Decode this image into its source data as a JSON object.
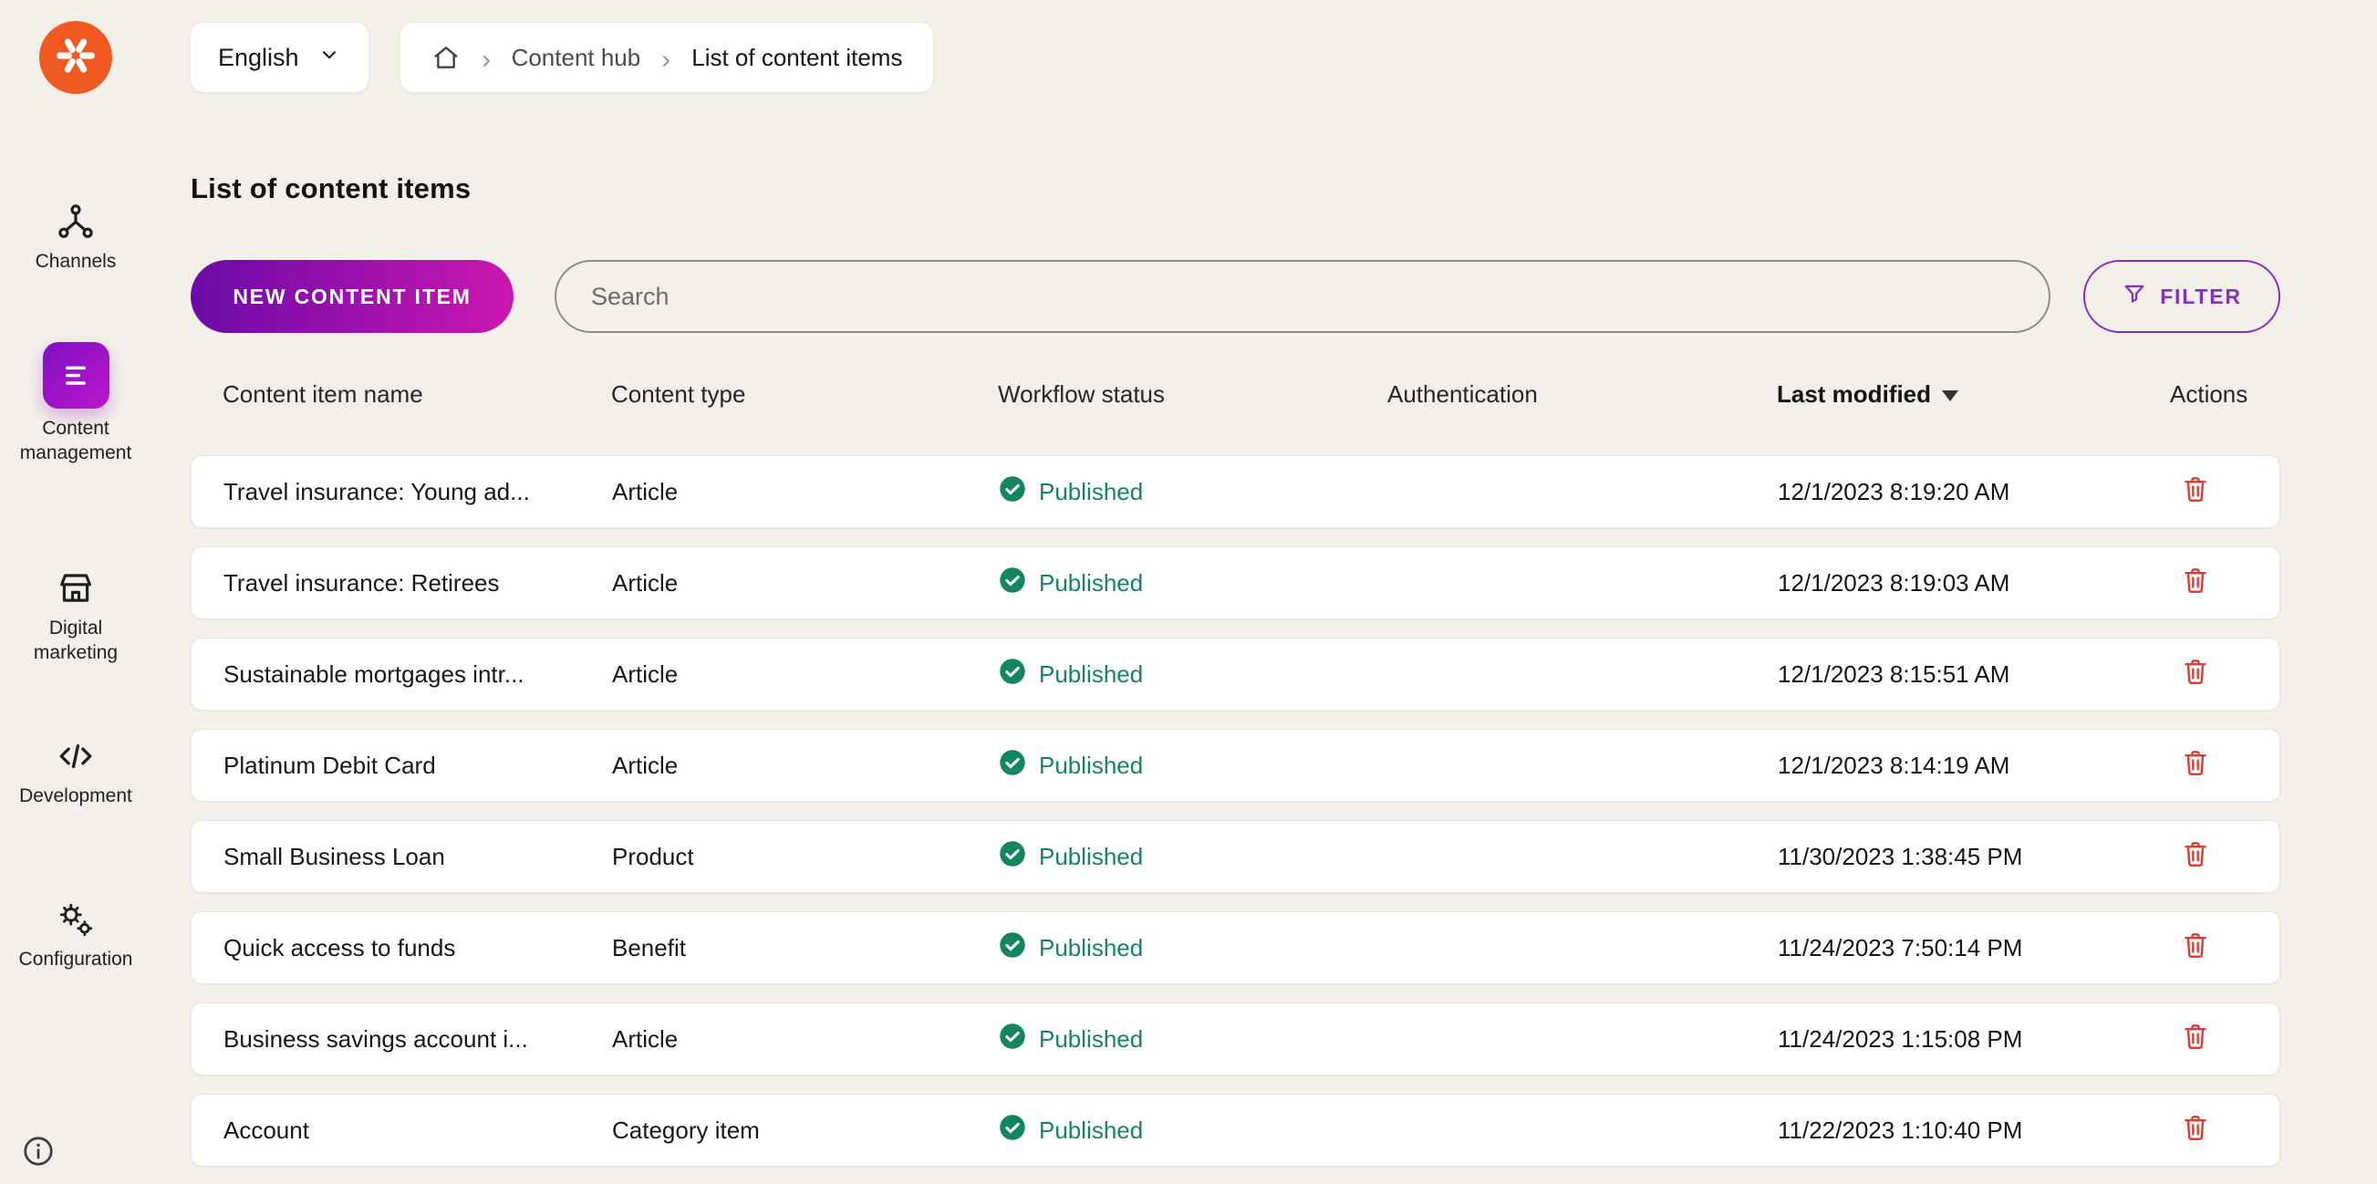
{
  "colors": {
    "brand_orange": "#F05A22",
    "accent_purple": "#8330C2",
    "new_button_gradient_start": "#6B0AA8",
    "new_button_gradient_end": "#CB17B0",
    "published_green": "#14865E",
    "delete_red": "#E13B30",
    "page_background": "#F3F0EA"
  },
  "sidebar": {
    "items": [
      {
        "label": "Channels"
      },
      {
        "label": "Content management"
      },
      {
        "label": "Digital marketing"
      },
      {
        "label": "Development"
      },
      {
        "label": "Configuration"
      }
    ],
    "active_item": "Content management"
  },
  "topbar": {
    "language_label": "English",
    "breadcrumb": [
      "Content hub",
      "List of content items"
    ]
  },
  "main": {
    "title": "List of content items",
    "new_button_label": "NEW CONTENT ITEM",
    "search_placeholder": "Search",
    "filter_label": "FILTER"
  },
  "table": {
    "columns": [
      "Content item name",
      "Content type",
      "Workflow status",
      "Authentication",
      "Last modified",
      "Actions"
    ],
    "sort": {
      "column": "Last modified",
      "direction": "desc"
    },
    "rows": [
      {
        "name": "Travel insurance: Young ad...",
        "type": "Article",
        "status": "Published",
        "auth": "",
        "modified": "12/1/2023 8:19:20 AM"
      },
      {
        "name": "Travel insurance: Retirees",
        "type": "Article",
        "status": "Published",
        "auth": "",
        "modified": "12/1/2023 8:19:03 AM"
      },
      {
        "name": "Sustainable mortgages intr...",
        "type": "Article",
        "status": "Published",
        "auth": "",
        "modified": "12/1/2023 8:15:51 AM"
      },
      {
        "name": "Platinum Debit Card",
        "type": "Article",
        "status": "Published",
        "auth": "",
        "modified": "12/1/2023 8:14:19 AM"
      },
      {
        "name": "Small Business Loan",
        "type": "Product",
        "status": "Published",
        "auth": "",
        "modified": "11/30/2023 1:38:45 PM"
      },
      {
        "name": "Quick access to funds",
        "type": "Benefit",
        "status": "Published",
        "auth": "",
        "modified": "11/24/2023 7:50:14 PM"
      },
      {
        "name": "Business savings account i...",
        "type": "Article",
        "status": "Published",
        "auth": "",
        "modified": "11/24/2023 1:15:08 PM"
      },
      {
        "name": "Account",
        "type": "Category item",
        "status": "Published",
        "auth": "",
        "modified": "11/22/2023 1:10:40 PM"
      }
    ]
  }
}
